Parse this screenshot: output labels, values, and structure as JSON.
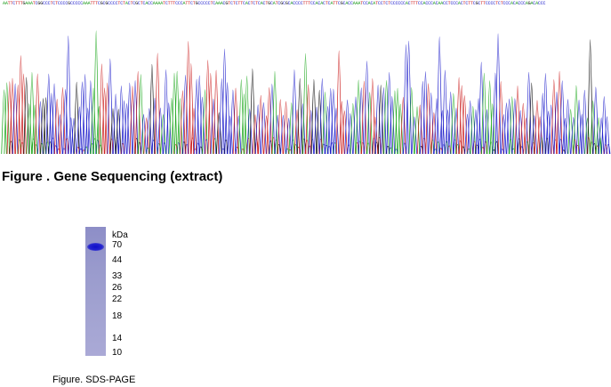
{
  "sequence_header": "AATTCTTTGAAATCGGCCCTCTCCCCGCCCCCAAATTTCGCGCCCCTCTACTCGCTCACCAAAATCTTTCCCATTCTGCCCCCTCAAACGTCTCTTCACTCTCACTGCATCGCGCACCCCTTTCCACACTCATTCGCACCAAATCCACATCCTCTCCCCCCACTTTCCACCCACAACCTCCCACTCTTCGCTTCCCCTCTCCCACACCCAGACACCC",
  "trace_colors": {
    "A": "#22aa22",
    "C": "#2222cc",
    "G": "#111111",
    "T": "#cc2222"
  },
  "figure1_caption": "Figure . Gene Sequencing (extract)",
  "gel": {
    "unit_label": "kDa",
    "markers": [
      "70",
      "44",
      "33",
      "26",
      "22",
      "18",
      "14",
      "10"
    ],
    "lane_color": "#9a9bcd",
    "band_color": "#1a1ad0"
  },
  "figure2_caption": "Figure. SDS-PAGE"
}
